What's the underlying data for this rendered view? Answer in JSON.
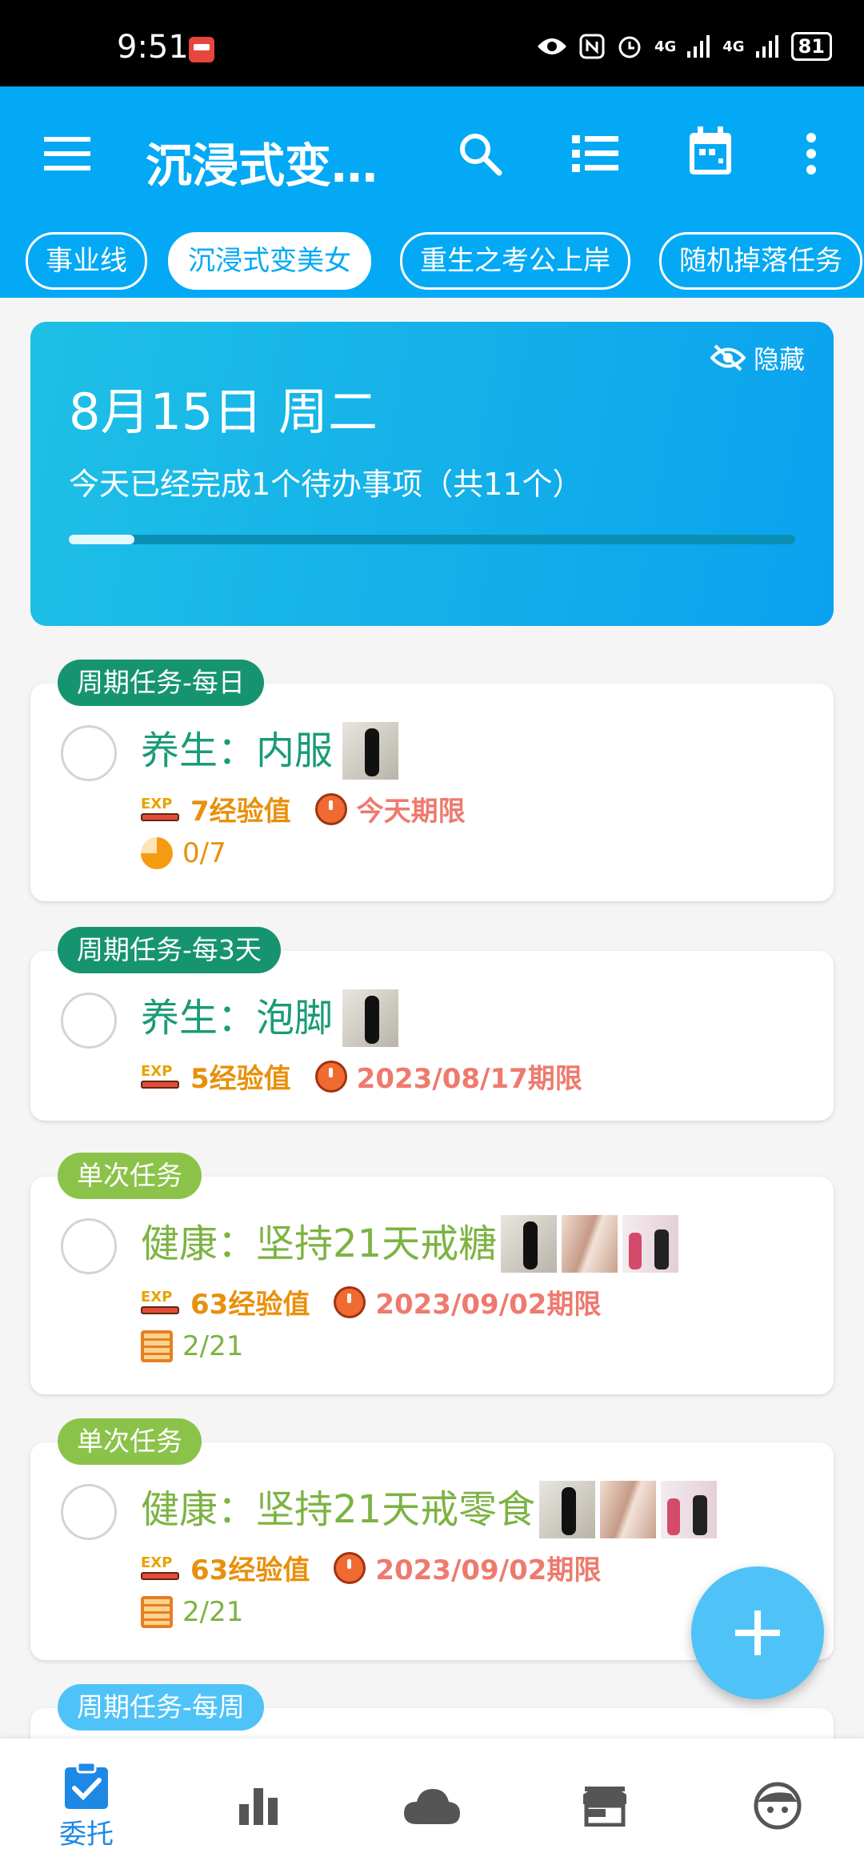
{
  "status_bar": {
    "time": "9:51",
    "battery": "81",
    "network": "4G"
  },
  "app_bar": {
    "title": "沉浸式变…"
  },
  "chips": [
    {
      "label": "事业线",
      "active": false
    },
    {
      "label": "沉浸式变美女",
      "active": true
    },
    {
      "label": "重生之考公上岸",
      "active": false
    },
    {
      "label": "随机掉落任务",
      "active": false
    }
  ],
  "summary": {
    "date": "8月15日 周二",
    "description": "今天已经完成1个待办事项（共11个）",
    "hide_label": "隐藏",
    "progress_fraction": 0.09
  },
  "tasks": [
    {
      "tag": "周期任务-每日",
      "tag_color": "#169470",
      "title": "养生：内服",
      "title_color": "#1a9b76",
      "exp": "7经验值",
      "deadline": "今天期限",
      "progress": "0/7",
      "progress_icon": "pie-icon"
    },
    {
      "tag": "周期任务-每3天",
      "tag_color": "#169470",
      "title": "养生：泡脚",
      "title_color": "#1a9b76",
      "exp": "5经验值",
      "deadline": "2023/08/17期限"
    },
    {
      "tag": "单次任务",
      "tag_color": "#8bc34a",
      "title": "健康：坚持21天戒糖",
      "title_color": "#7cb342",
      "exp": "63经验值",
      "deadline": "2023/09/02期限",
      "progress": "2/21",
      "progress_icon": "abacus-icon"
    },
    {
      "tag": "单次任务",
      "tag_color": "#8bc34a",
      "title": "健康：坚持21天戒零食",
      "title_color": "#7cb342",
      "exp": "63经验值",
      "deadline": "2023/09/02期限",
      "progress": "2/21",
      "progress_icon": "abacus-icon"
    },
    {
      "tag": "周期任务-每周",
      "tag_color": "#4fc3f7"
    }
  ],
  "colors": {
    "primary": "#03a9f4",
    "exp_text": "#e8900c",
    "deadline_text": "#ee7a6e",
    "progress_text_green": "#1a9b76",
    "progress_text_orange": "#8bc34a"
  },
  "bottom_nav": [
    {
      "label": "委托",
      "icon": "clipboard-check-icon",
      "active": true
    },
    {
      "icon": "bar-chart-icon"
    },
    {
      "icon": "cloud-icon"
    },
    {
      "icon": "store-icon"
    },
    {
      "icon": "avatar-face-icon"
    }
  ]
}
